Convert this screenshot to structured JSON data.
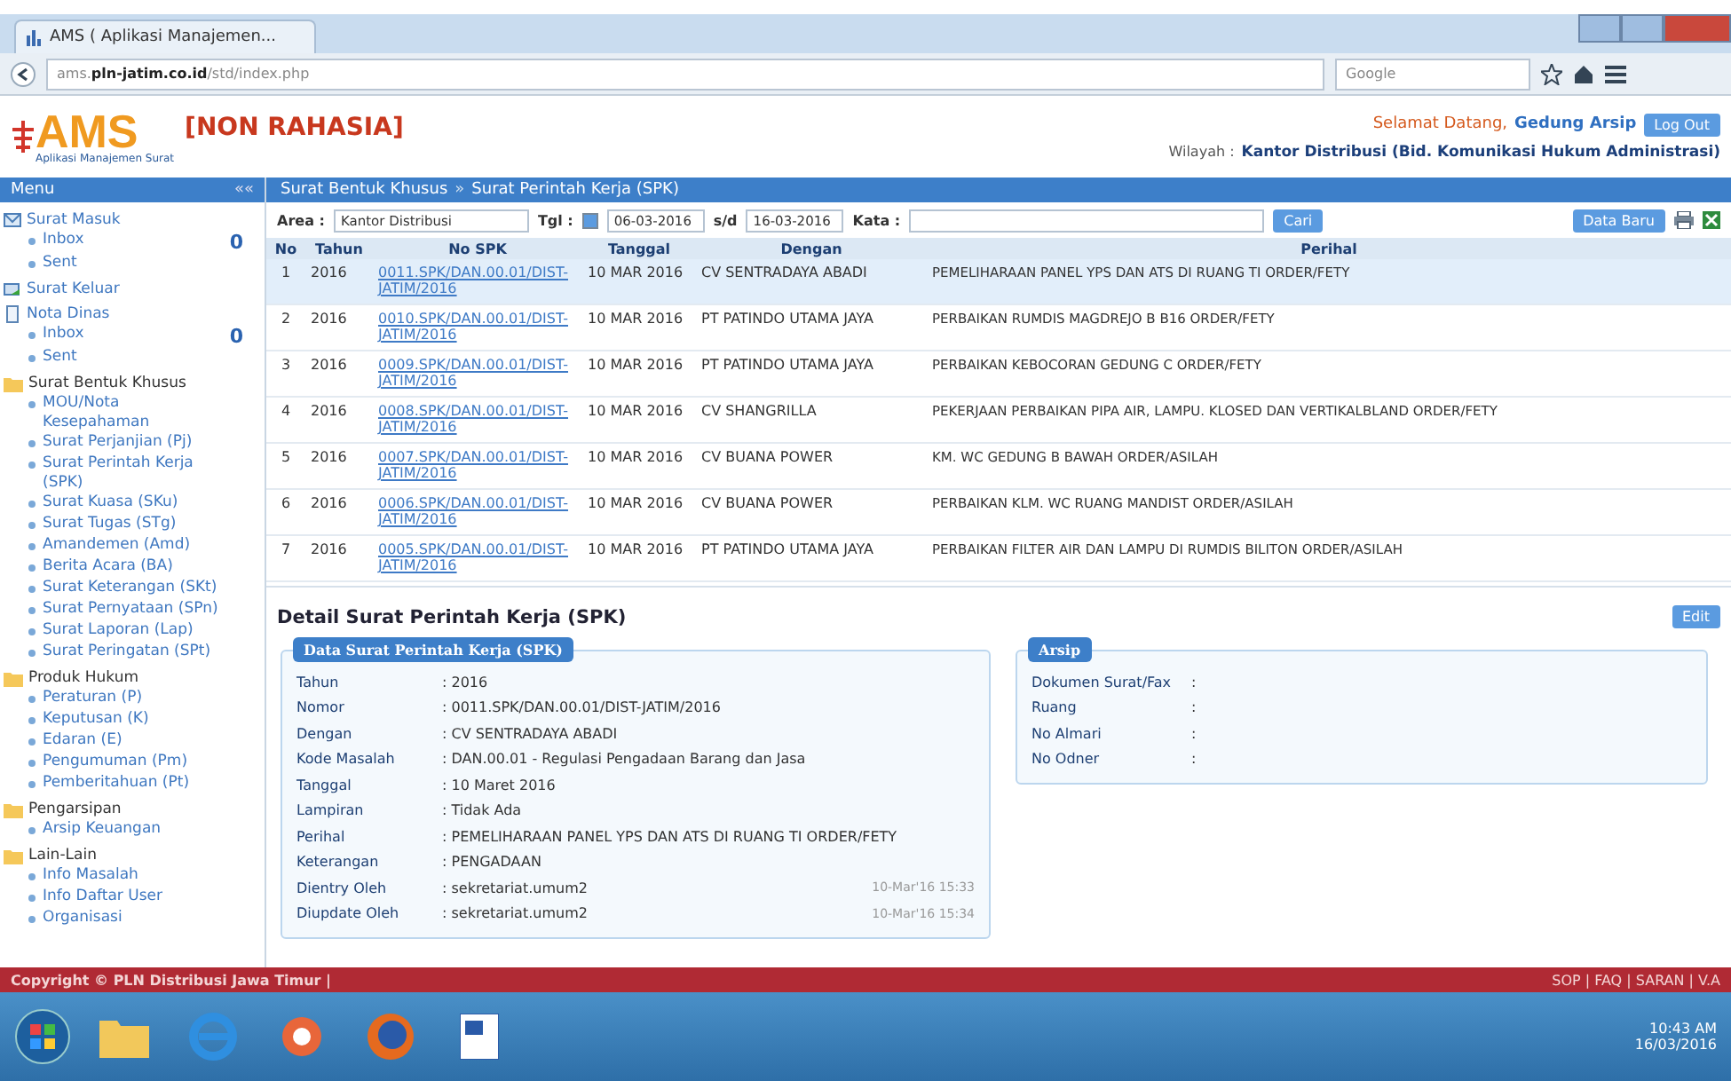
{
  "browser": {
    "tab_title": "AMS ( Aplikasi Manajemen...",
    "url_prefix": "ams.",
    "url_domain": "pln-jatim.co.id",
    "url_path": "/std/index.php",
    "search_placeholder": "Google"
  },
  "header": {
    "logo": "AMS",
    "logo_sub": "Aplikasi Manajemen Surat",
    "classification": "[NON RAHASIA]",
    "greeting": "Selamat Datang,",
    "user": "Gedung Arsip",
    "logout": "Log Out",
    "region_label": "Wilayah :",
    "region": "Kantor Distribusi (Bid. Komunikasi Hukum Administrasi)"
  },
  "sidebar": {
    "title": "Menu",
    "collapse": "««",
    "groups": [
      {
        "label": "Surat Masuk",
        "kind": "mail",
        "items": [
          {
            "label": "Inbox",
            "count": "0"
          },
          {
            "label": "Sent"
          }
        ]
      },
      {
        "label": "Surat Keluar",
        "kind": "outbox"
      },
      {
        "label": "Nota Dinas",
        "kind": "note",
        "items": [
          {
            "label": "Inbox",
            "count": "0"
          },
          {
            "label": "Sent"
          }
        ]
      },
      {
        "label": "Surat Bentuk Khusus",
        "kind": "folder",
        "items": [
          {
            "label": "MOU/Nota Kesepahaman"
          },
          {
            "label": "Surat Perjanjian (Pj)"
          },
          {
            "label": "Surat Perintah Kerja (SPK)"
          },
          {
            "label": "Surat Kuasa (SKu)"
          },
          {
            "label": "Surat Tugas (STg)"
          },
          {
            "label": "Amandemen (Amd)"
          },
          {
            "label": "Berita Acara (BA)"
          },
          {
            "label": "Surat Keterangan (SKt)"
          },
          {
            "label": "Surat Pernyataan (SPn)"
          },
          {
            "label": "Surat Laporan (Lap)"
          },
          {
            "label": "Surat Peringatan (SPt)"
          }
        ]
      },
      {
        "label": "Produk Hukum",
        "kind": "folder",
        "items": [
          {
            "label": "Peraturan (P)"
          },
          {
            "label": "Keputusan (K)"
          },
          {
            "label": "Edaran (E)"
          },
          {
            "label": "Pengumuman (Pm)"
          },
          {
            "label": "Pemberitahuan (Pt)"
          }
        ]
      },
      {
        "label": "Pengarsipan",
        "kind": "folder",
        "items": [
          {
            "label": "Arsip Keuangan"
          }
        ]
      },
      {
        "label": "Lain-Lain",
        "kind": "folder",
        "items": [
          {
            "label": "Info Masalah"
          },
          {
            "label": "Info Daftar User"
          },
          {
            "label": "Organisasi"
          }
        ]
      }
    ]
  },
  "breadcrumb": [
    "Surat Bentuk Khusus",
    "Surat Perintah Kerja (SPK)"
  ],
  "breadcrumb_separator": "»",
  "filter": {
    "area_label": "Area :",
    "area_value": "Kantor Distribusi",
    "date_label": "Tgl :",
    "date_checked": true,
    "date_from": "06-03-2016",
    "range_word": "s/d",
    "date_to": "16-03-2016",
    "keyword_label": "Kata :",
    "search_button": "Cari",
    "new_button": "Data Baru"
  },
  "table": {
    "columns": [
      "No",
      "Tahun",
      "No SPK",
      "Tanggal",
      "Dengan",
      "Perihal"
    ],
    "rows": [
      {
        "no": "1",
        "year": "2016",
        "number": "0011.SPK/DAN.00.01/DIST-JATIM/2016",
        "date": "10 MAR 2016",
        "party": "CV SENTRADAYA ABADI",
        "subject": "PEMELIHARAAN PANEL YPS DAN ATS DI RUANG TI ORDER/FETY",
        "selected": true
      },
      {
        "no": "2",
        "year": "2016",
        "number": "0010.SPK/DAN.00.01/DIST-JATIM/2016",
        "date": "10 MAR 2016",
        "party": "PT PATINDO UTAMA JAYA",
        "subject": "PERBAIKAN RUMDIS MAGDREJO B B16 ORDER/FETY",
        "selected": false
      },
      {
        "no": "3",
        "year": "2016",
        "number": "0009.SPK/DAN.00.01/DIST-JATIM/2016",
        "date": "10 MAR 2016",
        "party": "PT PATINDO UTAMA JAYA",
        "subject": "PERBAIKAN KEBOCORAN GEDUNG C ORDER/FETY",
        "selected": false
      },
      {
        "no": "4",
        "year": "2016",
        "number": "0008.SPK/DAN.00.01/DIST-JATIM/2016",
        "date": "10 MAR 2016",
        "party": "CV SHANGRILLA",
        "subject": "PEKERJAAN PERBAIKAN PIPA AIR, LAMPU. KLOSED DAN VERTIKALBLAND ORDER/FETY",
        "selected": false
      },
      {
        "no": "5",
        "year": "2016",
        "number": "0007.SPK/DAN.00.01/DIST-JATIM/2016",
        "date": "10 MAR 2016",
        "party": "CV BUANA POWER",
        "subject": "KM. WC GEDUNG B BAWAH ORDER/ASILAH",
        "selected": false
      },
      {
        "no": "6",
        "year": "2016",
        "number": "0006.SPK/DAN.00.01/DIST-JATIM/2016",
        "date": "10 MAR 2016",
        "party": "CV BUANA POWER",
        "subject": "PERBAIKAN KLM. WC RUANG MANDIST ORDER/ASILAH",
        "selected": false
      },
      {
        "no": "7",
        "year": "2016",
        "number": "0005.SPK/DAN.00.01/DIST-JATIM/2016",
        "date": "10 MAR 2016",
        "party": "PT PATINDO UTAMA JAYA",
        "subject": "PERBAIKAN FILTER AIR DAN LAMPU DI RUMDIS BILITON ORDER/ASILAH",
        "selected": false
      }
    ]
  },
  "detail": {
    "title": "Detail Surat Perintah Kerja (SPK)",
    "edit_button": "Edit",
    "panels": [
      {
        "title": "Data Surat Perintah Kerja (SPK)",
        "fields": [
          {
            "label": "Tahun",
            "value": ": 2016"
          },
          {
            "label": "Nomor",
            "value": ": 0011.SPK/DAN.00.01/DIST-JATIM/2016"
          },
          {
            "label": "Dengan",
            "value": ": CV SENTRADAYA ABADI"
          },
          {
            "label": "Kode Masalah",
            "value": ": DAN.00.01 - Regulasi Pengadaan Barang dan Jasa"
          },
          {
            "label": "Tanggal",
            "value": ": 10 Maret 2016"
          },
          {
            "label": "Lampiran",
            "value": ": Tidak Ada"
          },
          {
            "label": "Perihal",
            "value": ": PEMELIHARAAN PANEL YPS DAN ATS DI RUANG TI ORDER/FETY"
          },
          {
            "label": "Keterangan",
            "value": ": PENGADAAN"
          },
          {
            "label": "Dientry Oleh",
            "value": ": sekretariat.umum2",
            "time": "10-Mar'16 15:33"
          },
          {
            "label": "Diupdate Oleh",
            "value": ": sekretariat.umum2",
            "time": "10-Mar'16 15:34"
          }
        ]
      },
      {
        "title": "Arsip",
        "fields": [
          {
            "label": "Dokumen Surat/Fax",
            "value": ":"
          },
          {
            "label": "Ruang",
            "value": ":"
          },
          {
            "label": "No Almari",
            "value": ":"
          },
          {
            "label": "No Odner",
            "value": ":"
          }
        ]
      }
    ]
  },
  "footer": {
    "copyright": "Copyright © PLN Distribusi Jawa Timur |",
    "links": "SOP | FAQ | SARAN | V.A"
  },
  "taskbar": {
    "time": "10:43 AM",
    "date": "16/03/2016"
  }
}
